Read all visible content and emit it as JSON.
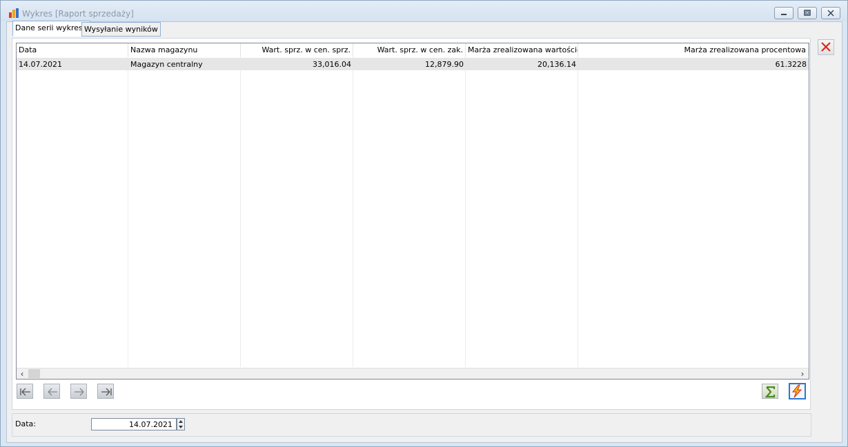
{
  "window": {
    "title": "Wykres [Raport sprzedaży]",
    "app_icon": "bar-chart-icon"
  },
  "tabs": [
    {
      "label": "Dane serii wykresu",
      "active": true
    },
    {
      "label": "Wysyłanie wyników",
      "active": false
    }
  ],
  "grid": {
    "columns": [
      "Data",
      "Nazwa magazynu",
      "Wart. sprz. w cen. sprz.",
      "Wart. sprz. w cen. zak.",
      "Marża zrealizowana wartościowa",
      "Marża zrealizowana procentowa"
    ],
    "rows": [
      [
        "14.07.2021",
        "Magazyn centralny",
        "33,016.04",
        "12,879.90",
        "20,136.14",
        "61.3228"
      ]
    ]
  },
  "nav_buttons": [
    "first-record-icon",
    "previous-record-icon",
    "next-record-icon",
    "last-record-icon"
  ],
  "actions": {
    "sum_icon": "sigma-icon",
    "refresh_icon": "lightning-icon",
    "close_icon": "close-icon"
  },
  "filter": {
    "label": "Data:",
    "value": "14.07.2021"
  },
  "colors": {
    "accent": "#2a78d0",
    "close_red": "#d9261c",
    "sum_green": "#4a8a1c"
  }
}
